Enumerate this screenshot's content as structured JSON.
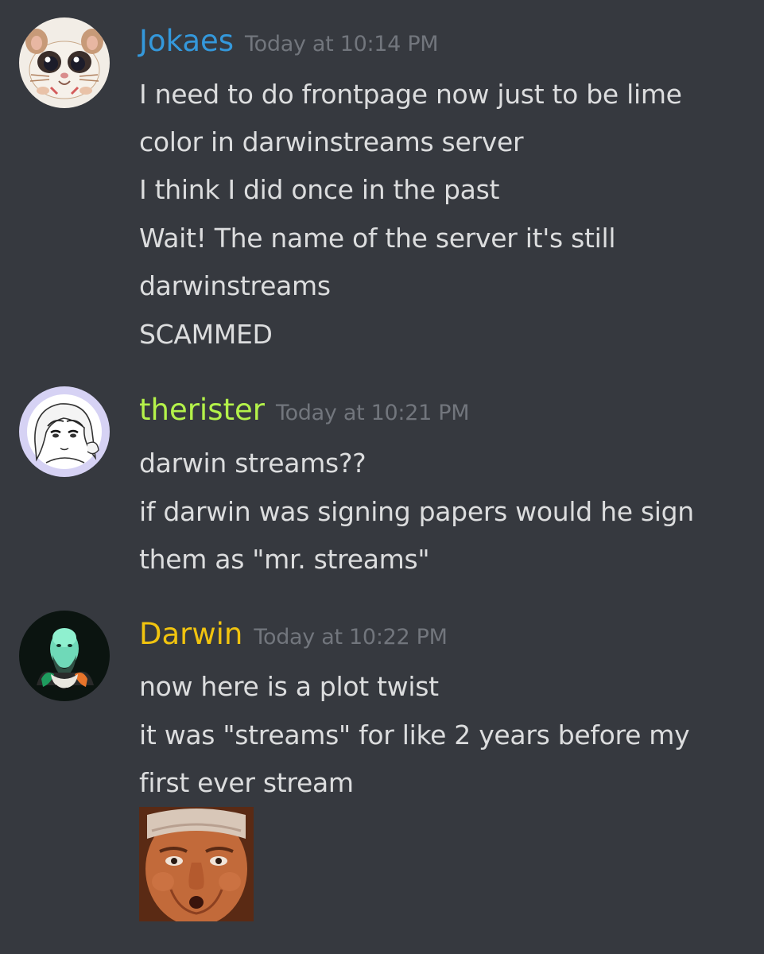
{
  "colors": {
    "background": "#36393f",
    "message_text": "#dcddde",
    "timestamp": "#72767d"
  },
  "messages": [
    {
      "author": "Jokaes",
      "author_color": "#3498db",
      "avatar_icon": "hamster-avatar",
      "timestamp": "Today at 10:14 PM",
      "lines": [
        "I need to do frontpage now just to be lime",
        "color in darwinstreams server",
        "I think I did once in the past",
        "Wait! The name of the server it's still",
        "darwinstreams",
        "SCAMMED"
      ]
    },
    {
      "author": "therister",
      "author_color": "#b4f24a",
      "avatar_icon": "anime-girl-avatar",
      "timestamp": "Today at 10:21 PM",
      "lines": [
        "darwin streams??",
        "if darwin was signing papers would he sign",
        "them as \"mr. streams\""
      ]
    },
    {
      "author": "Darwin",
      "author_color": "#f1c40f",
      "avatar_icon": "bearded-man-portrait-avatar",
      "timestamp": "Today at 10:22 PM",
      "lines": [
        "now here is a plot twist",
        "it was \"streams\" for like 2 years before my",
        "first ever stream"
      ],
      "attachment_icon": "shocked-face-image"
    }
  ]
}
